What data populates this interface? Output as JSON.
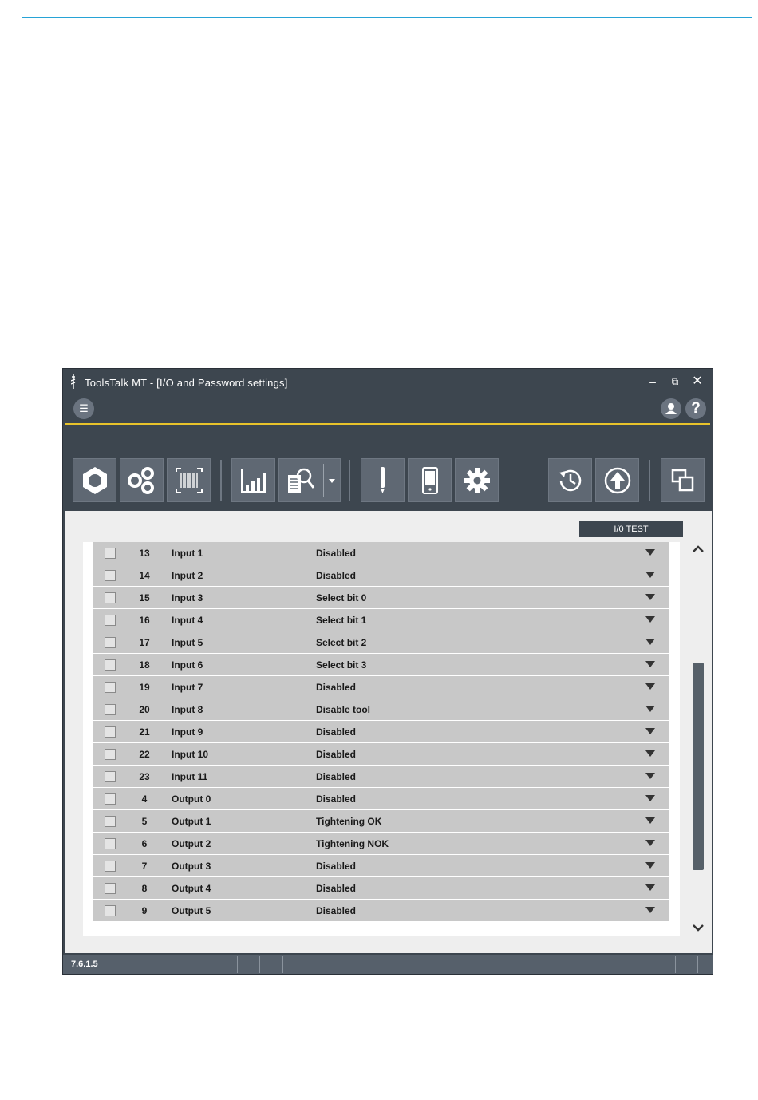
{
  "window": {
    "title": "ToolsTalk MT  - [I/O and Password settings]",
    "min_glyph": "‒",
    "max_glyph": "⧉",
    "close_glyph": "✕"
  },
  "header": {
    "menu_icon_glyph": "☰",
    "user_icon_glyph": "●",
    "help_glyph": "?"
  },
  "toolbar": {
    "buttons": [
      "tool-nut-icon",
      "multi-gears-icon",
      "barcode-icon",
      "bar-chart-icon",
      "search-document-icon",
      "dropdown-arrow-icon",
      "pen-icon",
      "mobile-device-icon",
      "gear-icon",
      "history-icon",
      "upload-icon",
      "windows-icon"
    ]
  },
  "content": {
    "io_test_label": "I/0 TEST",
    "rows": [
      {
        "num": "13",
        "name": "Input 1",
        "value": "Disabled"
      },
      {
        "num": "14",
        "name": "Input 2",
        "value": "Disabled"
      },
      {
        "num": "15",
        "name": "Input 3",
        "value": "Select bit 0"
      },
      {
        "num": "16",
        "name": "Input 4",
        "value": "Select bit 1"
      },
      {
        "num": "17",
        "name": "Input 5",
        "value": "Select bit 2"
      },
      {
        "num": "18",
        "name": "Input 6",
        "value": "Select bit 3"
      },
      {
        "num": "19",
        "name": "Input 7",
        "value": "Disabled"
      },
      {
        "num": "20",
        "name": "Input 8",
        "value": "Disable tool"
      },
      {
        "num": "21",
        "name": "Input 9",
        "value": "Disabled"
      },
      {
        "num": "22",
        "name": "Input 10",
        "value": "Disabled"
      },
      {
        "num": "23",
        "name": "Input 11",
        "value": "Disabled"
      },
      {
        "num": "4",
        "name": "Output 0",
        "value": "Disabled"
      },
      {
        "num": "5",
        "name": "Output 1",
        "value": "Tightening OK"
      },
      {
        "num": "6",
        "name": "Output 2",
        "value": "Tightening NOK"
      },
      {
        "num": "7",
        "name": "Output 3",
        "value": "Disabled"
      },
      {
        "num": "8",
        "name": "Output 4",
        "value": "Disabled"
      },
      {
        "num": "9",
        "name": "Output 5",
        "value": "Disabled"
      }
    ]
  },
  "status": {
    "version": "7.6.1.5"
  },
  "colors": {
    "accent_rule": "#27a3d6",
    "header_underline": "#e8c32b",
    "chrome": "#3d464f",
    "row_bg": "#c8c8c8"
  }
}
